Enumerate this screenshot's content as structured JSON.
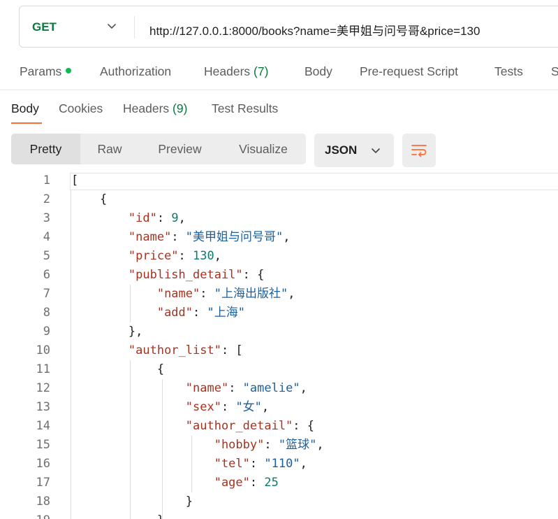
{
  "request": {
    "method": "GET",
    "url": "http://127.0.0.1:8000/books?name=美甲姐与问号哥&price=130"
  },
  "request_tabs": [
    {
      "label": "Params"
    },
    {
      "label": "Authorization"
    },
    {
      "label": "Headers",
      "count": "(7)"
    },
    {
      "label": "Body"
    },
    {
      "label": "Pre-request Script"
    },
    {
      "label": "Tests"
    },
    {
      "label": "S"
    }
  ],
  "response_tabs": [
    {
      "label": "Body"
    },
    {
      "label": "Cookies"
    },
    {
      "label": "Headers",
      "count": "(9)"
    },
    {
      "label": "Test Results"
    }
  ],
  "view_modes": [
    "Pretty",
    "Raw",
    "Preview",
    "Visualize"
  ],
  "format": "JSON",
  "code": {
    "line_numbers": [
      "1",
      "2",
      "3",
      "4",
      "5",
      "6",
      "7",
      "8",
      "9",
      "10",
      "11",
      "12",
      "13",
      "14",
      "15",
      "16",
      "17",
      "18",
      "19"
    ],
    "lines": [
      [
        [
          "p",
          "["
        ]
      ],
      [
        [
          "p",
          "    {"
        ]
      ],
      [
        [
          "p",
          "        "
        ],
        [
          "k",
          "\"id\""
        ],
        [
          "p",
          ": "
        ],
        [
          "n",
          "9"
        ],
        [
          "p",
          ","
        ]
      ],
      [
        [
          "p",
          "        "
        ],
        [
          "k",
          "\"name\""
        ],
        [
          "p",
          ": "
        ],
        [
          "s",
          "\"美甲姐与问号哥\""
        ],
        [
          "p",
          ","
        ]
      ],
      [
        [
          "p",
          "        "
        ],
        [
          "k",
          "\"price\""
        ],
        [
          "p",
          ": "
        ],
        [
          "n",
          "130"
        ],
        [
          "p",
          ","
        ]
      ],
      [
        [
          "p",
          "        "
        ],
        [
          "k",
          "\"publish_detail\""
        ],
        [
          "p",
          ": {"
        ]
      ],
      [
        [
          "p",
          "            "
        ],
        [
          "k",
          "\"name\""
        ],
        [
          "p",
          ": "
        ],
        [
          "s",
          "\"上海出版社\""
        ],
        [
          "p",
          ","
        ]
      ],
      [
        [
          "p",
          "            "
        ],
        [
          "k",
          "\"add\""
        ],
        [
          "p",
          ": "
        ],
        [
          "s",
          "\"上海\""
        ]
      ],
      [
        [
          "p",
          "        },"
        ]
      ],
      [
        [
          "p",
          "        "
        ],
        [
          "k",
          "\"author_list\""
        ],
        [
          "p",
          ": ["
        ]
      ],
      [
        [
          "p",
          "            {"
        ]
      ],
      [
        [
          "p",
          "                "
        ],
        [
          "k",
          "\"name\""
        ],
        [
          "p",
          ": "
        ],
        [
          "s",
          "\"amelie\""
        ],
        [
          "p",
          ","
        ]
      ],
      [
        [
          "p",
          "                "
        ],
        [
          "k",
          "\"sex\""
        ],
        [
          "p",
          ": "
        ],
        [
          "s",
          "\"女\""
        ],
        [
          "p",
          ","
        ]
      ],
      [
        [
          "p",
          "                "
        ],
        [
          "k",
          "\"author_detail\""
        ],
        [
          "p",
          ": {"
        ]
      ],
      [
        [
          "p",
          "                    "
        ],
        [
          "k",
          "\"hobby\""
        ],
        [
          "p",
          ": "
        ],
        [
          "s",
          "\"篮球\""
        ],
        [
          "p",
          ","
        ]
      ],
      [
        [
          "p",
          "                    "
        ],
        [
          "k",
          "\"tel\""
        ],
        [
          "p",
          ": "
        ],
        [
          "s",
          "\"110\""
        ],
        [
          "p",
          ","
        ]
      ],
      [
        [
          "p",
          "                    "
        ],
        [
          "k",
          "\"age\""
        ],
        [
          "p",
          ": "
        ],
        [
          "n",
          "25"
        ]
      ],
      [
        [
          "p",
          "                }"
        ]
      ],
      [
        [
          "p",
          "            }"
        ]
      ]
    ]
  },
  "colors": {
    "method": "#0a7a3e",
    "accent": "#ff6c37",
    "json_key": "#a8321f",
    "json_string": "#1b5f9e",
    "json_number": "#0d7a72"
  }
}
